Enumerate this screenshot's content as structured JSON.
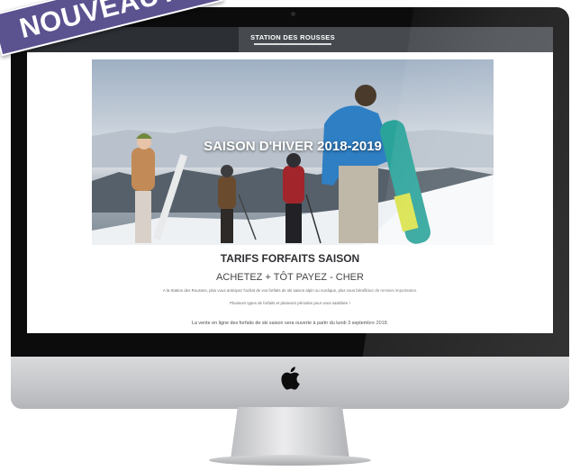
{
  "site": {
    "brand": "STATION DES ROUSSES"
  },
  "hero": {
    "title": "SAISON D'HIVER 2018-2019"
  },
  "section": {
    "title": "TARIFS FORFAITS SAISON",
    "subtitle": "ACHETEZ + TÔT PAYEZ - CHER",
    "paragraph": "A la Station des Rousses, plus vous anticipez l'achat de vos forfaits de ski saison alpin ou nordique, plus vous bénéficiez de remises importantes.",
    "paragraph2": "Plusieurs types de forfaits et plusieurs périodes pour vous satisfaire !",
    "notice": "La vente en ligne des forfaits de ski saison sera ouverte à partir du lundi 3 septembre 2018."
  },
  "banner": {
    "label": "NOUVEAUTÉ"
  },
  "colors": {
    "banner": "#5b5290",
    "monitor_bezel": "#0c0c0d",
    "topbar": "#2c2f33"
  },
  "icons": {
    "apple": "apple-logo-icon",
    "camera": "camera-icon"
  }
}
